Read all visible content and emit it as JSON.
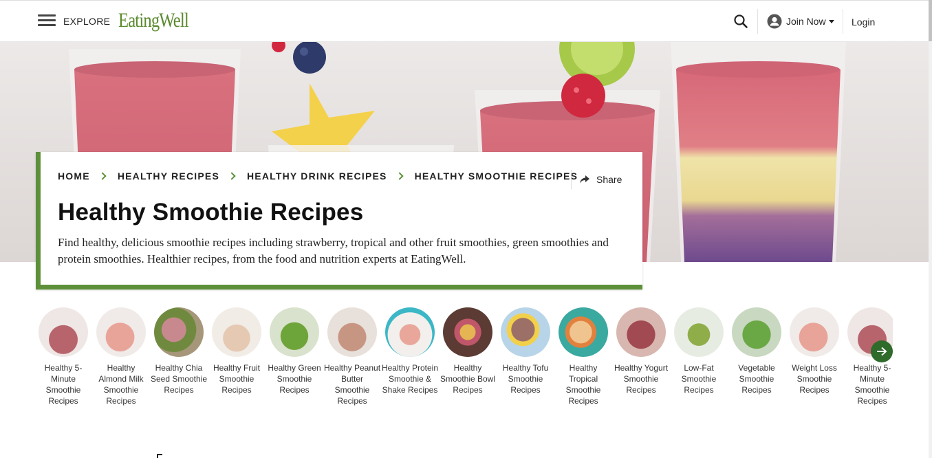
{
  "header": {
    "explore_label": "EXPLORE",
    "logo_text": "EatingWell",
    "join_label": "Join Now",
    "login_label": "Login",
    "icons": [
      "menu-icon",
      "search-icon",
      "user-icon",
      "caret-down-icon"
    ],
    "brand_color": "#5b8a2e"
  },
  "breadcrumbs": [
    {
      "label": "HOME"
    },
    {
      "label": "HEALTHY RECIPES"
    },
    {
      "label": "HEALTHY DRINK RECIPES"
    },
    {
      "label": "HEALTHY SMOOTHIE RECIPES"
    }
  ],
  "share_label": "Share",
  "page_title": "Healthy Smoothie Recipes",
  "page_description": "Find healthy, delicious smoothie recipes including strawberry, tropical and other fruit smoothies, green smoothies and protein smoothies. Healthier recipes, from the food and nutrition experts at EatingWell.",
  "accent_color": "#5d9038",
  "carousel": {
    "items": [
      {
        "label": "Healthy 5-Minute Smoothie Recipes"
      },
      {
        "label": "Healthy Almond Milk Smoothie Recipes"
      },
      {
        "label": "Healthy Chia Seed Smoothie Recipes"
      },
      {
        "label": "Healthy Fruit Smoothie Recipes"
      },
      {
        "label": "Healthy Green Smoothie Recipes"
      },
      {
        "label": "Healthy Peanut Butter Smoothie Recipes"
      },
      {
        "label": "Healthy Protein Smoothie & Shake Recipes"
      },
      {
        "label": "Healthy Smoothie Bowl Recipes"
      },
      {
        "label": "Healthy Tofu Smoothie Recipes"
      },
      {
        "label": "Healthy Tropical Smoothie Recipes"
      },
      {
        "label": "Healthy Yogurt Smoothie Recipes"
      },
      {
        "label": "Low-Fat Smoothie Recipes"
      },
      {
        "label": "Vegetable Smoothie Recipes"
      },
      {
        "label": "Weight Loss Smoothie Recipes"
      },
      {
        "label": "Healthy 5-Minute Smoothie Recipes"
      }
    ],
    "next_icon": "arrow-right-icon"
  }
}
